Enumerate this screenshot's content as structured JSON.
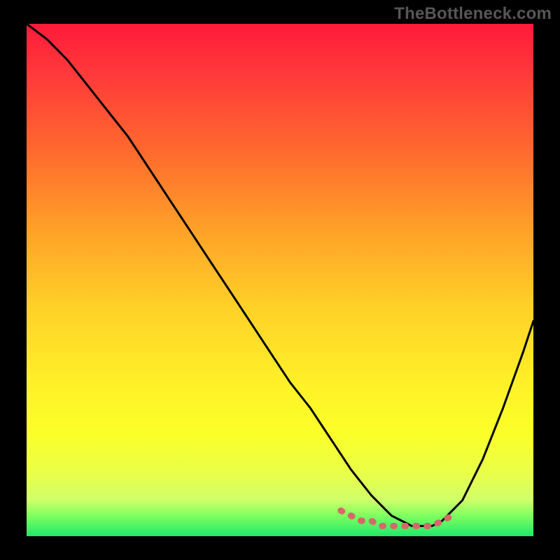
{
  "watermark": "TheBottleneck.com",
  "chart_data": {
    "type": "line",
    "title": "",
    "xlabel": "",
    "ylabel": "",
    "xlim": [
      0,
      100
    ],
    "ylim": [
      0,
      100
    ],
    "grid": false,
    "legend": false,
    "background_gradient": {
      "top": "#ff1a3a",
      "bottom": "#20e86a"
    },
    "series": [
      {
        "name": "bottleneck-curve",
        "color": "#000000",
        "x": [
          0,
          4,
          8,
          12,
          16,
          20,
          24,
          28,
          32,
          36,
          40,
          44,
          48,
          52,
          56,
          60,
          64,
          68,
          70,
          72,
          74,
          76,
          78,
          80,
          82,
          86,
          90,
          94,
          98,
          100
        ],
        "y": [
          100,
          97,
          93,
          88,
          83,
          78,
          72,
          66,
          60,
          54,
          48,
          42,
          36,
          30,
          25,
          19,
          13,
          8,
          6,
          4,
          3,
          2,
          2,
          2,
          3,
          7,
          15,
          25,
          36,
          42
        ]
      },
      {
        "name": "optimal-range-marker",
        "color": "#d6686a",
        "x": [
          62,
          64,
          66,
          68,
          70,
          72,
          74,
          76,
          78,
          80,
          82,
          84
        ],
        "y": [
          5,
          4,
          3,
          3,
          2,
          2,
          2,
          2,
          2,
          2,
          3,
          4
        ]
      }
    ]
  }
}
